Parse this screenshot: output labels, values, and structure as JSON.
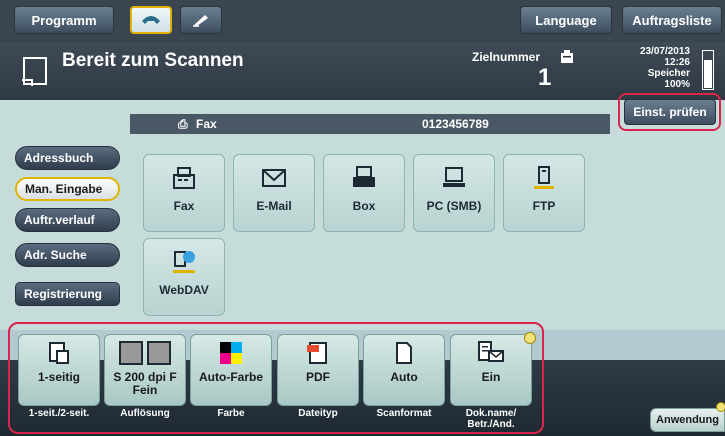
{
  "topbar": {
    "programm": "Programm",
    "language": "Language",
    "auftragsliste": "Auftragsliste"
  },
  "status": {
    "title": "Bereit zum Scannen",
    "ziel_label": "Zielnummer",
    "ziel_value": "1",
    "date": "23/07/2013",
    "time": "12:26",
    "speicher": "Speicher",
    "speicher_pct": "100%"
  },
  "einst_pruefen": "Einst. prüfen",
  "faxbar": {
    "label": "Fax",
    "number": "0123456789"
  },
  "left_menu": [
    {
      "label": "Adressbuch"
    },
    {
      "label": "Man. Eingabe"
    },
    {
      "label": "Auftr.verlauf"
    },
    {
      "label": "Adr. Suche"
    },
    {
      "label": "Registrierung"
    }
  ],
  "destinations": [
    {
      "label": "Fax",
      "icon": "fax-icon"
    },
    {
      "label": "E-Mail",
      "icon": "email-icon"
    },
    {
      "label": "Box",
      "icon": "box-icon"
    },
    {
      "label": "PC (SMB)",
      "icon": "pc-icon"
    },
    {
      "label": "FTP",
      "icon": "ftp-icon"
    },
    {
      "label": "WebDAV",
      "icon": "webdav-icon"
    }
  ],
  "options": [
    {
      "value": "1-seitig",
      "label": "1-seit./2-seit.",
      "icon": "simplex-icon"
    },
    {
      "value": "S 200 dpi F Fein",
      "label": "Auflösung",
      "icon": "resolution-icon"
    },
    {
      "value": "Auto-Farbe",
      "label": "Farbe",
      "icon": "color-icon"
    },
    {
      "value": "PDF",
      "label": "Dateityp",
      "icon": "pdf-icon"
    },
    {
      "value": "Auto",
      "label": "Scanformat",
      "icon": "scan-size-icon"
    },
    {
      "value": "Ein",
      "label": "Dok.name/ Betr./And.",
      "icon": "document-name-icon"
    }
  ],
  "anwendung": "Anwendung",
  "colors": {
    "teal_bg": "#c6dcda",
    "dark_bar": "#3a4550",
    "highlight": "#d7264a",
    "accent_yellow": "#e0b300"
  }
}
